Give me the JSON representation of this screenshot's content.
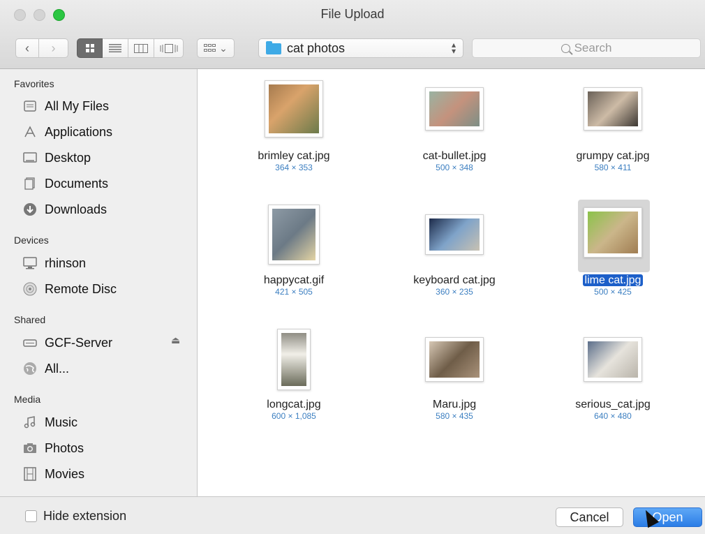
{
  "window": {
    "title": "File Upload"
  },
  "toolbar": {
    "back_glyph": "‹",
    "forward_glyph": "›",
    "view_buttons": [
      "icon-view",
      "list-view",
      "column-view",
      "cover-flow-view"
    ],
    "arrange_glyph": "⌄",
    "location": "cat photos",
    "search_placeholder": "Search"
  },
  "sidebar": {
    "sections": [
      {
        "heading": "Favorites",
        "items": [
          {
            "label": "All My Files",
            "icon": "all-files-icon"
          },
          {
            "label": "Applications",
            "icon": "applications-icon"
          },
          {
            "label": "Desktop",
            "icon": "desktop-icon"
          },
          {
            "label": "Documents",
            "icon": "documents-icon"
          },
          {
            "label": "Downloads",
            "icon": "downloads-icon"
          }
        ]
      },
      {
        "heading": "Devices",
        "items": [
          {
            "label": "rhinson",
            "icon": "computer-icon"
          },
          {
            "label": "Remote Disc",
            "icon": "disc-icon"
          }
        ]
      },
      {
        "heading": "Shared",
        "items": [
          {
            "label": "GCF-Server",
            "icon": "server-icon"
          },
          {
            "label": "All...",
            "icon": "network-icon"
          }
        ]
      },
      {
        "heading": "Media",
        "items": [
          {
            "label": "Music",
            "icon": "music-icon"
          },
          {
            "label": "Photos",
            "icon": "camera-icon"
          },
          {
            "label": "Movies",
            "icon": "film-icon"
          }
        ]
      }
    ]
  },
  "files": [
    {
      "name": "brimley cat.jpg",
      "dims": "364 × 353",
      "selected": false
    },
    {
      "name": "cat-bullet.jpg",
      "dims": "500 × 348",
      "selected": false
    },
    {
      "name": "grumpy cat.jpg",
      "dims": "580 × 411",
      "selected": false
    },
    {
      "name": "happycat.gif",
      "dims": "421 × 505",
      "selected": false
    },
    {
      "name": "keyboard cat.jpg",
      "dims": "360 × 235",
      "selected": false
    },
    {
      "name": "lime cat.jpg",
      "dims": "500 × 425",
      "selected": true
    },
    {
      "name": "longcat.jpg",
      "dims": "600 × 1,085",
      "selected": false
    },
    {
      "name": "Maru.jpg",
      "dims": "580 × 435",
      "selected": false
    },
    {
      "name": "serious_cat.jpg",
      "dims": "640 × 480",
      "selected": false
    }
  ],
  "bottom": {
    "hide_extension_label": "Hide extension",
    "cancel_label": "Cancel",
    "open_label": "Open"
  },
  "colors": {
    "accent": "#2b7de6",
    "selection": "#1c5fc9",
    "dimension_text": "#3c7fc1",
    "zoom_button": "#2bc642"
  }
}
